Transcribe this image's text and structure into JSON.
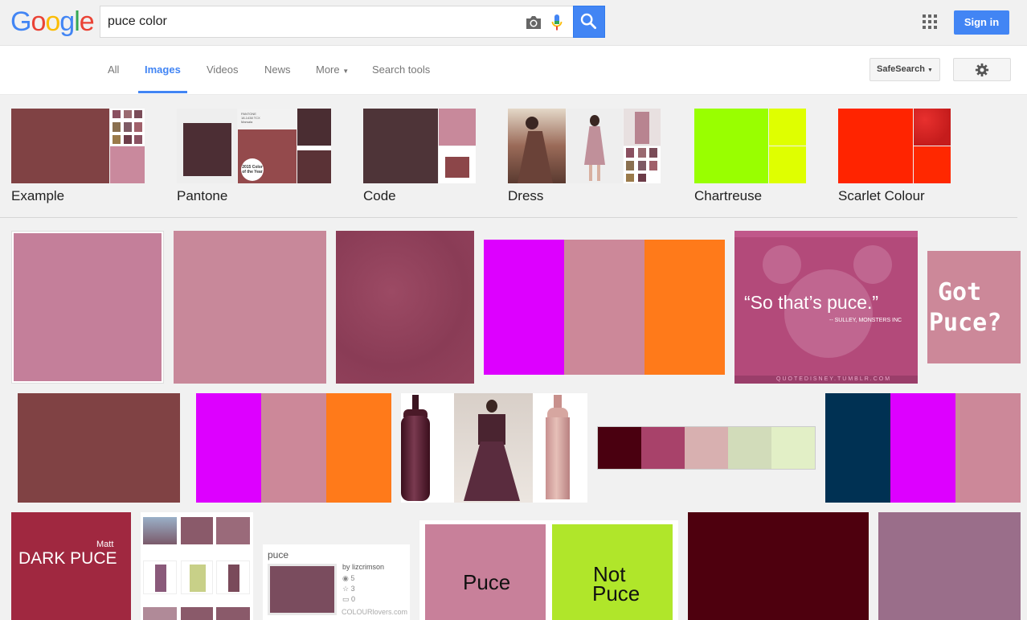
{
  "header": {
    "logo_letters": [
      "G",
      "o",
      "o",
      "g",
      "l",
      "e"
    ],
    "search_value": "puce color",
    "sign_in_label": "Sign in"
  },
  "icons": {
    "camera": "camera-icon",
    "mic": "microphone-icon",
    "search": "magnifier-icon",
    "apps": "apps-grid-icon",
    "gear": "gear-icon"
  },
  "tabs": {
    "all": "All",
    "images": "Images",
    "videos": "Videos",
    "news": "News",
    "more": "More",
    "tools": "Search tools",
    "safesearch": "SafeSearch"
  },
  "related": [
    {
      "label": "Example"
    },
    {
      "label": "Pantone"
    },
    {
      "label": "Code"
    },
    {
      "label": "Dress"
    },
    {
      "label": "Chartreuse"
    },
    {
      "label": "Scarlet Colour"
    }
  ],
  "thumb_text": {
    "pantone_small": "PANTONE\n18-1438 TCX\nMarsala",
    "pantone_badge": "2015 Color of the Year",
    "quote": "“So that’s puce.”",
    "quote_attr": "-- SULLEY, MONSTERS INC",
    "quote_url": "QUOTEDISNEY.TUMBLR.COM",
    "got_puce_1": "Got",
    "got_puce_2": "Puce?",
    "dark_puce_matt": "Matt",
    "dark_puce": "DARK PUCE",
    "cl_title": "puce",
    "cl_by": "by lizcrimson",
    "cl_views": "5",
    "cl_loves": "3",
    "cl_comments": "0",
    "cl_site": "COLOURlovers.com",
    "puce_label": "Puce",
    "not_puce_1": "Not",
    "not_puce_2": "Puce"
  },
  "colors": {
    "google_blue": "#4285f4",
    "google_red": "#ea4335",
    "google_yellow": "#fbbc05",
    "google_green": "#34a853",
    "puce": "#cc8899",
    "magenta": "#dd00ff",
    "orange": "#ff7a1a"
  }
}
